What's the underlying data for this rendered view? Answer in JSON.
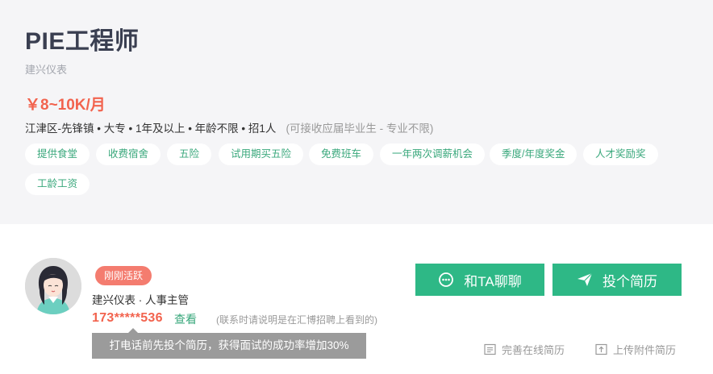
{
  "job": {
    "title": "PIE工程师",
    "company": "建兴仪表",
    "salary": "￥8~10K/月",
    "meta": "江津区-先锋镇 • 大专 • 1年及以上 • 年龄不限 • 招1人",
    "meta_note": "(可接收应届毕业生 - 专业不限)",
    "tags": [
      "提供食堂",
      "收费宿舍",
      "五险",
      "试用期买五险",
      "免费班车",
      "一年两次调薪机会",
      "季度/年度奖金",
      "人才奖励奖",
      "工龄工资"
    ]
  },
  "recruiter": {
    "badge": "刚刚活跃",
    "name": "建兴仪表 · 人事主管",
    "phone": "173*****536",
    "view_label": "查看",
    "contact_note": "(联系时请说明是在汇博招聘上看到的)",
    "tooltip": "打电话前先投个简历，获得面试的成功率增加30%"
  },
  "actions": {
    "chat_label": "和TA聊聊",
    "apply_label": "投个简历",
    "online_resume_label": "完善在线简历",
    "upload_resume_label": "上传附件简历"
  },
  "colors": {
    "accent": "#2eb886",
    "salary": "#f2634e",
    "badge": "#f47c6f",
    "header_bg": "#f5f5f7"
  },
  "icons": {
    "chat": "chat-bubble-icon",
    "apply": "paper-plane-icon",
    "online_resume": "document-icon",
    "upload_resume": "upload-icon"
  }
}
